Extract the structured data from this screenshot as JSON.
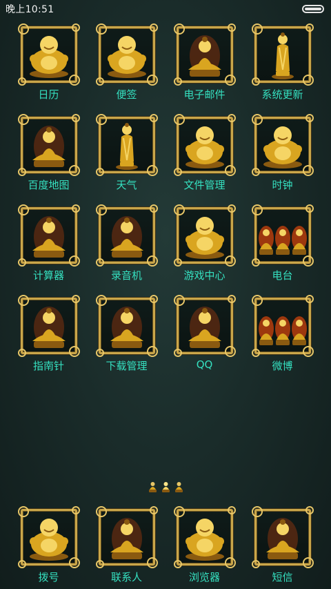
{
  "status": {
    "time": "晚上10:51"
  },
  "apps": [
    {
      "label": "日历",
      "icon": "laughing-buddha-icon",
      "kind": "laugh"
    },
    {
      "label": "便签",
      "icon": "laughing-buddha-icon",
      "kind": "laugh"
    },
    {
      "label": "电子邮件",
      "icon": "seated-buddha-icon",
      "kind": "seated"
    },
    {
      "label": "系统更新",
      "icon": "standing-buddha-icon",
      "kind": "standing"
    },
    {
      "label": "百度地图",
      "icon": "seated-buddha-icon",
      "kind": "seated"
    },
    {
      "label": "天气",
      "icon": "standing-buddha-icon",
      "kind": "standing"
    },
    {
      "label": "文件管理",
      "icon": "laughing-buddha-icon",
      "kind": "laugh"
    },
    {
      "label": "时钟",
      "icon": "laughing-buddha-icon",
      "kind": "laugh"
    },
    {
      "label": "计算器",
      "icon": "seated-buddha-icon",
      "kind": "seated"
    },
    {
      "label": "录音机",
      "icon": "seated-buddha-icon",
      "kind": "seated"
    },
    {
      "label": "游戏中心",
      "icon": "laughing-buddha-icon",
      "kind": "laugh"
    },
    {
      "label": "电台",
      "icon": "three-buddhas-icon",
      "kind": "trio"
    },
    {
      "label": "指南针",
      "icon": "seated-buddha-icon",
      "kind": "seated"
    },
    {
      "label": "下载管理",
      "icon": "seated-buddha-icon",
      "kind": "seated"
    },
    {
      "label": "QQ",
      "icon": "seated-buddha-icon",
      "kind": "seated"
    },
    {
      "label": "微博",
      "icon": "three-buddhas-icon",
      "kind": "trio"
    }
  ],
  "dock": [
    {
      "label": "拨号",
      "icon": "laughing-buddha-icon",
      "kind": "laugh"
    },
    {
      "label": "联系人",
      "icon": "seated-buddha-icon",
      "kind": "seated"
    },
    {
      "label": "浏览器",
      "icon": "laughing-buddha-icon",
      "kind": "laugh"
    },
    {
      "label": "短信",
      "icon": "seated-buddha-icon",
      "kind": "seated"
    }
  ],
  "pager": {
    "pages": 3,
    "active": 1
  }
}
